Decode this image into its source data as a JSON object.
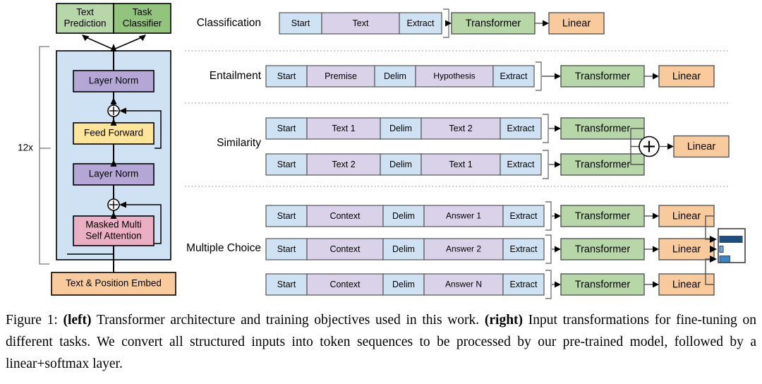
{
  "figure": {
    "left_panel": {
      "repeat_label": "12x",
      "output_heads": [
        {
          "label_line1": "Text",
          "label_line2": "Prediction",
          "color": "#b7d7a8"
        },
        {
          "label_line1": "Task",
          "label_line2": "Classifier",
          "color": "#93c47d"
        }
      ],
      "blocks": [
        {
          "name": "layer-norm-top",
          "label": "Layer Norm",
          "color": "#b4a7d6"
        },
        {
          "name": "feed-forward",
          "label": "Feed Forward",
          "color": "#ffe599"
        },
        {
          "name": "layer-norm-bottom",
          "label": "Layer Norm",
          "color": "#b4a7d6"
        },
        {
          "name": "masked-multi-self-attention",
          "label_line1": "Masked Multi",
          "label_line2": "Self Attention",
          "color": "#ebafc4"
        }
      ],
      "embedding": {
        "label": "Text & Position Embed",
        "color": "#f9cb9c"
      },
      "stack_background": "#cfe2f3",
      "residual_symbol": "+"
    },
    "tasks": [
      {
        "name": "classification",
        "label": "Classification",
        "rows": [
          {
            "tokens": [
              {
                "label": "Start",
                "kind": "special"
              },
              {
                "label": "Text",
                "kind": "text"
              },
              {
                "label": "Extract",
                "kind": "special"
              }
            ],
            "transformer": "Transformer",
            "linear": "Linear"
          }
        ]
      },
      {
        "name": "entailment",
        "label": "Entailment",
        "rows": [
          {
            "tokens": [
              {
                "label": "Start",
                "kind": "special"
              },
              {
                "label": "Premise",
                "kind": "text"
              },
              {
                "label": "Delim",
                "kind": "special"
              },
              {
                "label": "Hypothesis",
                "kind": "text"
              },
              {
                "label": "Extract",
                "kind": "special"
              }
            ],
            "transformer": "Transformer",
            "linear": "Linear"
          }
        ]
      },
      {
        "name": "similarity",
        "label": "Similarity",
        "combine_symbol": "+",
        "linear": "Linear",
        "rows": [
          {
            "tokens": [
              {
                "label": "Start",
                "kind": "special"
              },
              {
                "label": "Text 1",
                "kind": "text"
              },
              {
                "label": "Delim",
                "kind": "special"
              },
              {
                "label": "Text 2",
                "kind": "text"
              },
              {
                "label": "Extract",
                "kind": "special"
              }
            ],
            "transformer": "Transformer"
          },
          {
            "tokens": [
              {
                "label": "Start",
                "kind": "special"
              },
              {
                "label": "Text 2",
                "kind": "text"
              },
              {
                "label": "Delim",
                "kind": "special"
              },
              {
                "label": "Text 1",
                "kind": "text"
              },
              {
                "label": "Extract",
                "kind": "special"
              }
            ],
            "transformer": "Transformer"
          }
        ]
      },
      {
        "name": "multiple-choice",
        "label": "Multiple Choice",
        "rows": [
          {
            "tokens": [
              {
                "label": "Start",
                "kind": "special"
              },
              {
                "label": "Context",
                "kind": "text"
              },
              {
                "label": "Delim",
                "kind": "special"
              },
              {
                "label": "Answer 1",
                "kind": "text"
              },
              {
                "label": "Extract",
                "kind": "special"
              }
            ],
            "transformer": "Transformer",
            "linear": "Linear"
          },
          {
            "tokens": [
              {
                "label": "Start",
                "kind": "special"
              },
              {
                "label": "Context",
                "kind": "text"
              },
              {
                "label": "Delim",
                "kind": "special"
              },
              {
                "label": "Answer 2",
                "kind": "text"
              },
              {
                "label": "Extract",
                "kind": "special"
              }
            ],
            "transformer": "Transformer",
            "linear": "Linear"
          },
          {
            "tokens": [
              {
                "label": "Start",
                "kind": "special"
              },
              {
                "label": "Context",
                "kind": "text"
              },
              {
                "label": "Delim",
                "kind": "special"
              },
              {
                "label": "Answer N",
                "kind": "text"
              },
              {
                "label": "Extract",
                "kind": "special"
              }
            ],
            "transformer": "Transformer",
            "linear": "Linear"
          }
        ],
        "softmax_bars": [
          {
            "value": 1.0,
            "color": "#1c4e80"
          },
          {
            "value": 0.12,
            "color": "#6fa8dc"
          },
          {
            "value": 0.45,
            "color": "#3d85c8"
          }
        ]
      }
    ],
    "colors": {
      "special_token": "#cfe2f3",
      "text_token": "#d9d2e9",
      "transformer": "#b7d7a8",
      "linear": "#f9cb9c",
      "border": "#555555",
      "dark_border": "#000000",
      "divider": "#b0b0c0"
    }
  },
  "caption": {
    "number": "Figure 1:",
    "bold1": "(left)",
    "text1": " Transformer architecture and training objectives used in this work. ",
    "bold2": "(right)",
    "text2": " Input transformations for fine-tuning on different tasks.  We convert all structured inputs into token sequences to be processed by our pre-trained model, followed by a linear+softmax layer."
  }
}
